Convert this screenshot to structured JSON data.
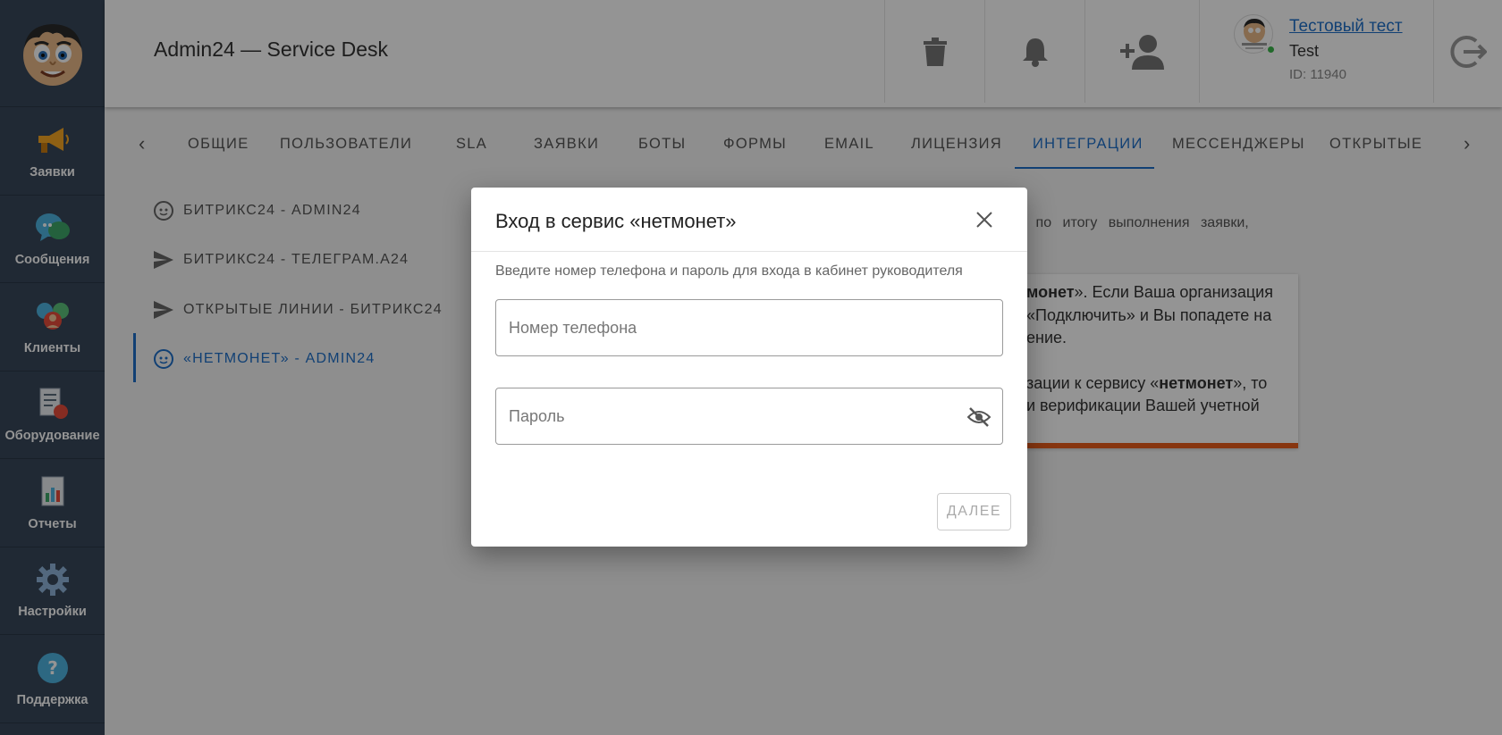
{
  "sidebar": {
    "items": [
      {
        "label": "Заявки",
        "icon": "megaphone-icon"
      },
      {
        "label": "Сообщения",
        "icon": "chat-bubbles-icon"
      },
      {
        "label": "Клиенты",
        "icon": "clients-icon"
      },
      {
        "label": "Оборудование",
        "icon": "equipment-icon"
      },
      {
        "label": "Отчеты",
        "icon": "reports-icon"
      },
      {
        "label": "Настройки",
        "icon": "gear-icon"
      },
      {
        "label": "Поддержка",
        "icon": "help-icon"
      }
    ]
  },
  "header": {
    "title": "Admin24 — Service Desk",
    "user": {
      "name": "Тестовый тест",
      "subtitle": "Test",
      "id": "ID: 11940"
    }
  },
  "tabs": {
    "items": [
      "ОБЩИЕ",
      "ПОЛЬЗОВАТЕЛИ",
      "SLA",
      "ЗАЯВКИ",
      "БОТЫ",
      "ФОРМЫ",
      "EMAIL",
      "ЛИЦЕНЗИЯ",
      "ИНТЕГРАЦИИ",
      "МЕССЕНДЖЕРЫ",
      "ОТКРЫТЫЕ ЛИ"
    ],
    "active": "ИНТЕГРАЦИИ"
  },
  "integrations": {
    "items": [
      {
        "label": "БИТРИКС24 - ADMIN24"
      },
      {
        "label": "БИТРИКС24 - ТЕЛЕГРАМ.А24"
      },
      {
        "label": "ОТКРЫТЫЕ ЛИНИИ - БИТРИКС24"
      },
      {
        "label": "«НЕТМОНЕТ» - ADMIN24"
      }
    ]
  },
  "background": {
    "text_line": "енту, по итогу выполнения заявки,",
    "card": {
      "line1_bold": "монет",
      "line1_rest": "». Если Ваша организация",
      "line2": "«Подключить» и Вы попадете на",
      "line3": "ение.",
      "line4_pre": "зации к сервису «",
      "line4_bold": "нетмонет",
      "line4_post": "», то",
      "line5": "и верификации Вашей учетной"
    },
    "card_accent": "#e85d1c"
  },
  "modal": {
    "title": "Вход в сервис «нетмонет»",
    "description": "Введите номер телефона и пароль для входа в кабинет руководителя",
    "phone_placeholder": "Номер телефона",
    "phone_value": "",
    "password_placeholder": "Пароль",
    "password_value": "",
    "next_label": "ДАЛЕЕ"
  },
  "colors": {
    "sidebar_bg": "#37475a",
    "accent": "#1e6fc8",
    "online": "#3bb54a"
  }
}
